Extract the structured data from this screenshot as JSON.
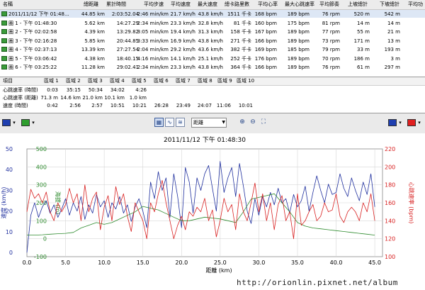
{
  "laps": {
    "headers": [
      "名稱",
      "總距離",
      "累計時間",
      "平均步速",
      "平均速度",
      "最大速度",
      "總卡路里數",
      "平均心率",
      "最大心跳速率",
      "平均節奏",
      "上坡總計",
      "下坡總計",
      "平均功"
    ],
    "rows": [
      [
        "2011/11/12 下午 01:48...",
        "44.85 km",
        "2:03:52.04",
        "2:46 min/km",
        "21.7 km/h",
        "43.8 km/h",
        "1511 千卡",
        "168 bpm",
        "189 bpm",
        "76 rpm",
        "520 m",
        "542 m",
        ""
      ],
      [
        "圈 1 - 下午 01:48:30",
        "5.62 km",
        "14:27.29",
        "2:34 min/km",
        "23.3 km/h",
        "32.8 km/h",
        "81 千卡",
        "160 bpm",
        "175 bpm",
        "81 rpm",
        "14 m",
        "14 m",
        ""
      ],
      [
        "圈 2 - 下午 02:02:58",
        "4.39 km",
        "13:29.82",
        "3:05 min/km",
        "19.4 km/h",
        "31.3 km/h",
        "158 千卡",
        "167 bpm",
        "189 bpm",
        "77 rpm",
        "55 m",
        "21 m",
        ""
      ],
      [
        "圈 3 - 下午 02:16:28",
        "5.85 km",
        "20:44.85",
        "3:33 min/km",
        "16.9 km/h",
        "43.8 km/h",
        "271 千卡",
        "166 bpm",
        "189 bpm",
        "73 rpm",
        "171 m",
        "13 m",
        ""
      ],
      [
        "圈 4 - 下午 02:37:13",
        "13.39 km",
        "27:27.54",
        "2:04 min/km",
        "29.2 km/h",
        "43.6 km/h",
        "382 千卡",
        "169 bpm",
        "185 bpm",
        "79 rpm",
        "33 m",
        "193 m",
        ""
      ],
      [
        "圈 5 - 下午 03:06:42",
        "4.38 km",
        "18:40.15",
        "4:16 min/km",
        "14.1 km/h",
        "25.1 km/h",
        "252 千卡",
        "176 bpm",
        "189 bpm",
        "70 rpm",
        "186 m",
        "3 m",
        ""
      ],
      [
        "圈 6 - 下午 03:25:22",
        "11.28 km",
        "29:02.41",
        "2:34 min/km",
        "23.3 km/h",
        "43.8 km/h",
        "364 千卡",
        "166 bpm",
        "189 bpm",
        "76 rpm",
        "61 m",
        "297 m",
        ""
      ]
    ]
  },
  "zones": {
    "headers": [
      "項目",
      "區域 1",
      "區域 2",
      "區域 3",
      "區域 4",
      "區域 5",
      "區域 6",
      "區域 7",
      "區域 8",
      "區域 9",
      "區域 10"
    ],
    "rows": [
      [
        "心跳速率 (時間)",
        "0:03",
        "35:15",
        "50:34",
        "34:02",
        "4:26",
        "",
        "",
        "",
        "",
        ""
      ],
      [
        "心跳速率 (距離)",
        "71.3 m",
        "14.6 km",
        "21.0 km",
        "10.1 km",
        "1.0 km",
        "",
        "",
        "",
        "",
        ""
      ],
      [
        "速度 (時間)",
        "0:42",
        "2:56",
        "2:57",
        "10:51",
        "10:21",
        "26:28",
        "23:49",
        "24:07",
        "11:06",
        "10:01"
      ]
    ]
  },
  "toolbar": {
    "left_color_1": "#1f3fb0",
    "left_color_2": "#2e9e2e",
    "right_color_1": "#1f3fb0",
    "right_color_2": "#e02020",
    "x_axis_select": "距離",
    "buttons": [
      "chart-view-icon",
      "graph-view-icon",
      "split-view-icon",
      "zoom-in-icon",
      "zoom-out-icon",
      "fit-icon"
    ]
  },
  "chart_data": {
    "type": "line",
    "title": "2011/11/12 下午 01:48:30",
    "xlabel": "距離 (km)",
    "x_ticks": [
      "0.0",
      "5.0",
      "10.0",
      "15.0",
      "20.0",
      "25.0",
      "30.0",
      "35.0",
      "40.0",
      "45.0"
    ],
    "xlim": [
      0,
      46
    ],
    "y1": {
      "label": "速度 (km/h)",
      "color": "#1f2f9e",
      "ticks": [
        "0",
        "10",
        "20",
        "30",
        "40",
        "50"
      ],
      "lim": [
        -2,
        50
      ]
    },
    "y2": {
      "label": "海拔 (m)",
      "color": "#2e8b2e",
      "ticks": [
        "-100",
        "0",
        "100",
        "200",
        "300",
        "400",
        "500"
      ],
      "lim": [
        -100,
        500
      ]
    },
    "y3": {
      "label": "心跳速率 (bpm)",
      "color": "#d82020",
      "ticks": [
        "100",
        "120",
        "140",
        "160",
        "180",
        "200",
        "220"
      ],
      "lim": [
        100,
        220
      ]
    },
    "series": [
      {
        "name": "speed",
        "axis": "y1",
        "color": "#1f2f9e",
        "x": [
          0,
          0.5,
          1,
          1.5,
          2,
          2.5,
          3,
          3.5,
          4,
          4.5,
          5,
          5.5,
          6,
          6.5,
          7,
          7.5,
          8,
          8.5,
          9,
          9.5,
          10,
          10.5,
          11,
          11.5,
          12,
          12.5,
          13,
          13.5,
          14,
          14.5,
          15,
          15.5,
          16,
          16.5,
          17,
          17.5,
          18,
          18.5,
          19,
          19.5,
          20,
          20.5,
          21,
          21.5,
          22,
          22.5,
          23,
          23.5,
          24,
          24.5,
          25,
          25.5,
          26,
          26.5,
          27,
          27.5,
          28,
          28.5,
          29,
          29.5,
          30,
          30.5,
          31,
          31.5,
          32,
          32.5,
          33,
          33.5,
          34,
          34.5,
          35,
          35.5,
          36,
          36.5,
          37,
          37.5,
          38,
          38.5,
          39,
          39.5,
          40,
          40.5,
          41,
          41.5,
          42,
          42.5,
          43,
          43.5,
          44,
          44.5,
          45
        ],
        "values": [
          0,
          18,
          24,
          17,
          22,
          25,
          19,
          23,
          17,
          21,
          26,
          18,
          24,
          20,
          27,
          16,
          23,
          19,
          28,
          22,
          25,
          17,
          24,
          21,
          27,
          19,
          23,
          15,
          22,
          26,
          20,
          12,
          34,
          26,
          39,
          30,
          36,
          17,
          38,
          27,
          12,
          41,
          34,
          19,
          36,
          30,
          38,
          42,
          31,
          20,
          44,
          29,
          36,
          41,
          27,
          43,
          32,
          20,
          14,
          26,
          18,
          27,
          22,
          29,
          23,
          31,
          24,
          26,
          19,
          28,
          22,
          25,
          32,
          20,
          29,
          37,
          30,
          24,
          33,
          28,
          29,
          38,
          31,
          27,
          36,
          30,
          25,
          34,
          28,
          38,
          22
        ]
      },
      {
        "name": "altitude",
        "axis": "y2",
        "color": "#2e8b2e",
        "x": [
          0,
          1,
          2,
          3,
          4,
          5,
          6,
          7,
          8,
          9,
          10,
          11,
          12,
          13,
          14,
          15,
          16,
          17,
          18,
          19,
          20,
          21,
          22,
          23,
          24,
          25,
          26,
          27,
          28,
          29,
          30,
          31,
          32,
          33,
          34,
          35,
          36,
          37,
          38,
          39,
          40,
          41,
          42,
          43,
          44,
          45
        ],
        "values": [
          20,
          20,
          22,
          25,
          28,
          30,
          35,
          60,
          75,
          90,
          80,
          90,
          110,
          130,
          150,
          180,
          170,
          160,
          140,
          120,
          100,
          100,
          110,
          120,
          115,
          110,
          100,
          90,
          150,
          220,
          230,
          240,
          250,
          200,
          150,
          90,
          70,
          60,
          55,
          50,
          45,
          40,
          35,
          30,
          25,
          20
        ]
      },
      {
        "name": "heart-rate",
        "axis": "y3",
        "color": "#d82020",
        "x": [
          0,
          0.5,
          1,
          1.5,
          2,
          2.5,
          3,
          3.5,
          4,
          4.5,
          5,
          5.5,
          6,
          6.5,
          7,
          7.5,
          8,
          8.5,
          9,
          9.5,
          10,
          10.5,
          11,
          11.5,
          12,
          12.5,
          13,
          13.5,
          14,
          14.5,
          15,
          15.5,
          16,
          16.5,
          17,
          17.5,
          18,
          18.5,
          19,
          19.5,
          20,
          20.5,
          21,
          21.5,
          22,
          22.5,
          23,
          23.5,
          24,
          24.5,
          25,
          25.5,
          26,
          26.5,
          27,
          27.5,
          28,
          28.5,
          29,
          29.5,
          30,
          30.5,
          31,
          31.5,
          32,
          32.5,
          33,
          33.5,
          34,
          34.5,
          35,
          35.5,
          36,
          36.5,
          37,
          37.5,
          38,
          38.5,
          39,
          39.5,
          40,
          40.5,
          41,
          41.5,
          42,
          42.5,
          43,
          43.5,
          44,
          44.5,
          45
        ],
        "values": [
          150,
          175,
          165,
          170,
          160,
          172,
          150,
          140,
          160,
          150,
          158,
          176,
          160,
          170,
          140,
          180,
          150,
          165,
          172,
          130,
          155,
          168,
          140,
          178,
          158,
          170,
          145,
          128,
          160,
          150,
          140,
          120,
          160,
          150,
          170,
          185,
          160,
          140,
          120,
          135,
          145,
          130,
          150,
          145,
          155,
          150,
          165,
          140,
          152,
          122,
          140,
          165,
          150,
          158,
          130,
          170,
          150,
          140,
          160,
          182,
          150,
          170,
          140,
          160,
          130,
          158,
          168,
          140,
          150,
          120,
          170,
          135,
          140,
          150,
          158,
          140,
          145,
          160,
          150,
          152,
          170,
          145,
          138,
          150,
          155,
          150,
          140,
          160,
          150,
          170,
          140
        ]
      }
    ]
  },
  "watermark": "http://orionlin.pixnet.net/album"
}
